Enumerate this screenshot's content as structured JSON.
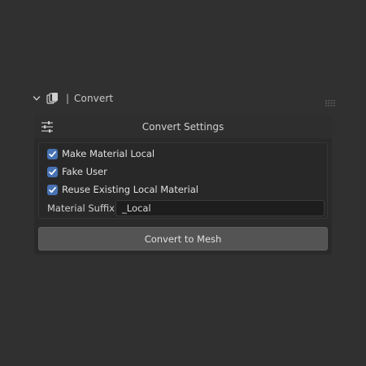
{
  "panel": {
    "title": "Convert",
    "separator": "|",
    "icons": {
      "collapse": "chevron-down-icon",
      "node": "node-tree-icon",
      "drag": "drag-handle-icon"
    }
  },
  "settings": {
    "title": "Convert Settings",
    "icon": "sliders-icon",
    "checkboxes": [
      {
        "label": "Make Material Local",
        "checked": true
      },
      {
        "label": "Fake User",
        "checked": true
      },
      {
        "label": "Reuse Existing Local Material",
        "checked": true
      }
    ],
    "suffix_label": "Material Suffix:",
    "suffix_value": "_Local"
  },
  "action": {
    "convert_label": "Convert to Mesh"
  },
  "colors": {
    "background": "#303030",
    "panel": "#2a2a2a",
    "checkbox_accent": "#4772b3",
    "button": "#545454"
  }
}
